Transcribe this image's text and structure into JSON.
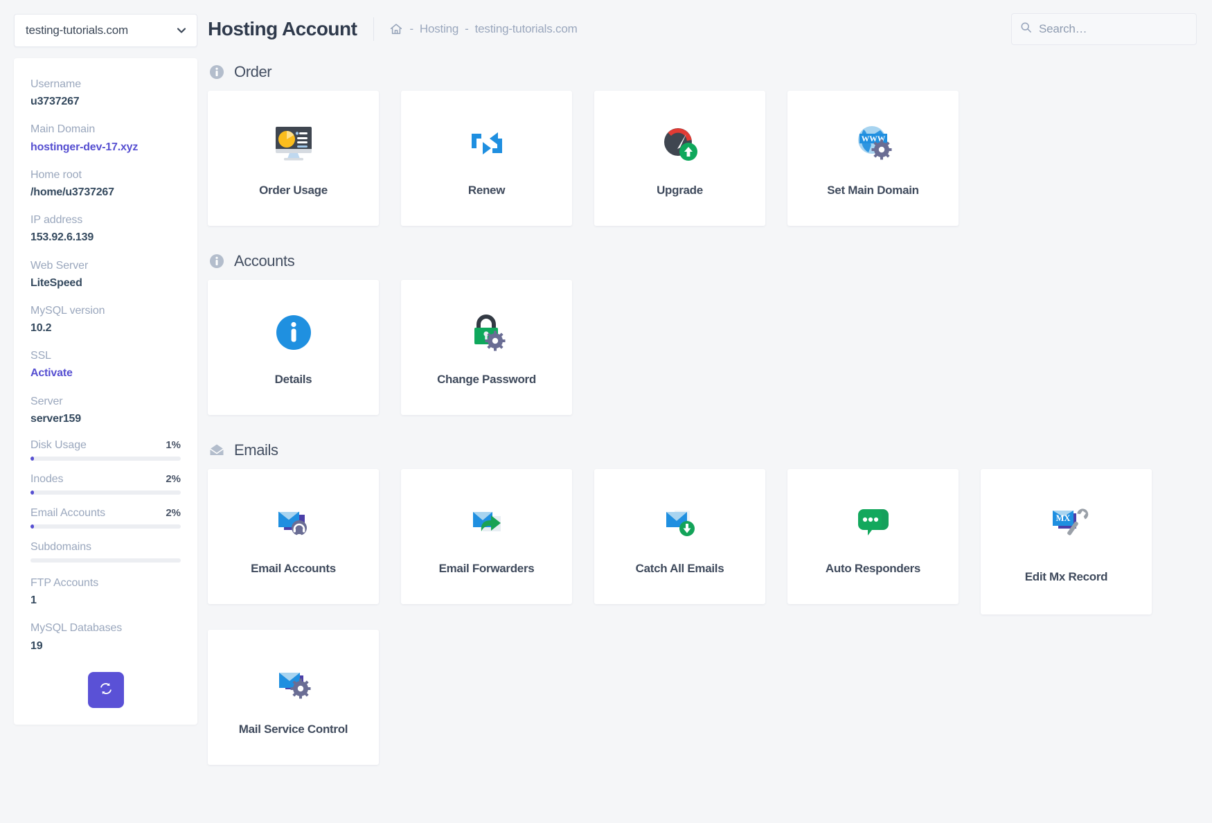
{
  "sidebar": {
    "domain_selector": {
      "value": "testing-tutorials.com",
      "chevron_icon": "chevron-down-icon"
    },
    "fields": [
      {
        "label": "Username",
        "value": "u3737267",
        "style": "plain"
      },
      {
        "label": "Main Domain",
        "value": "hostinger-dev-17.xyz",
        "style": "link"
      },
      {
        "label": "Home root",
        "value": "/home/u3737267",
        "style": "plain"
      },
      {
        "label": "IP address",
        "value": "153.92.6.139",
        "style": "plain"
      },
      {
        "label": "Web Server",
        "value": "LiteSpeed",
        "style": "plain"
      },
      {
        "label": "MySQL version",
        "value": "10.2",
        "style": "plain"
      },
      {
        "label": "SSL",
        "value": "Activate",
        "style": "link"
      },
      {
        "label": "Server",
        "value": "server159",
        "style": "plain"
      }
    ],
    "meters": [
      {
        "label": "Disk Usage",
        "value": "1%",
        "percent": 1
      },
      {
        "label": "Inodes",
        "value": "2%",
        "percent": 2
      },
      {
        "label": "Email Accounts",
        "value": "2%",
        "percent": 2
      },
      {
        "label": "Subdomains",
        "value": "",
        "percent": 0
      }
    ],
    "counts": [
      {
        "label": "FTP Accounts",
        "value": "1"
      },
      {
        "label": "MySQL Databases",
        "value": "19"
      }
    ],
    "refresh_button": {
      "icon": "refresh-icon",
      "label": ""
    },
    "accent_color": "#564fd1"
  },
  "header": {
    "title": "Hosting Account",
    "breadcrumb": {
      "home_icon": "home-icon",
      "separator": "-",
      "items": [
        "Hosting",
        "testing-tutorials.com"
      ]
    },
    "search": {
      "icon": "search-icon",
      "placeholder": "Search…",
      "value": ""
    }
  },
  "sections": [
    {
      "id": "order",
      "icon": "info-circle-icon",
      "title": "Order",
      "cards": [
        {
          "label": "Order Usage",
          "icon": "monitor-pie-chart-icon"
        },
        {
          "label": "Renew",
          "icon": "renew-loop-icon"
        },
        {
          "label": "Upgrade",
          "icon": "speedometer-upgrade-icon"
        },
        {
          "label": "Set Main Domain",
          "icon": "globe-www-gear-icon"
        }
      ]
    },
    {
      "id": "accounts",
      "icon": "info-circle-icon",
      "title": "Accounts",
      "cards": [
        {
          "label": "Details",
          "icon": "info-circle-blue-icon"
        },
        {
          "label": "Change Password",
          "icon": "padlock-gear-icon"
        }
      ]
    },
    {
      "id": "emails",
      "icon": "envelope-open-icon",
      "title": "Emails",
      "cards": [
        {
          "label": "Email Accounts",
          "icon": "envelope-headset-icon"
        },
        {
          "label": "Email Forwarders",
          "icon": "envelope-forward-icon"
        },
        {
          "label": "Catch All Emails",
          "icon": "envelope-download-icon"
        },
        {
          "label": "Auto Responders",
          "icon": "chat-bubbles-icon"
        },
        {
          "label": "Edit Mx Record",
          "icon": "envelope-mx-wrench-icon",
          "tall": true
        },
        {
          "label": "Mail Service Control",
          "icon": "envelope-gear-icon"
        }
      ]
    }
  ]
}
